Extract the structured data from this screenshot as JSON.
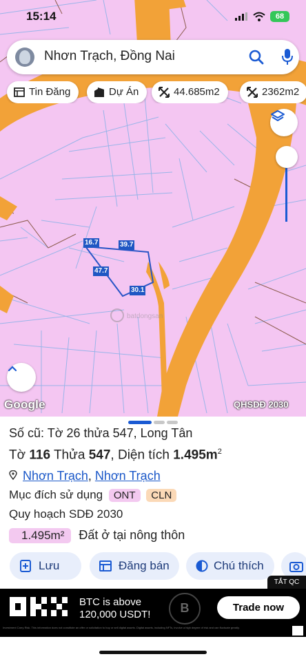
{
  "status_bar": {
    "time": "15:14",
    "battery": "68"
  },
  "search": {
    "query": "Nhơn Trạch, Đồng Nai"
  },
  "chips": [
    {
      "label": "Tin Đăng",
      "icon": "listing-icon"
    },
    {
      "label": "Dự Án",
      "icon": "building-icon"
    },
    {
      "label": "44.685m2",
      "icon": "area-icon"
    },
    {
      "label": "2362m2",
      "icon": "area-icon"
    }
  ],
  "map": {
    "google_label": "Google",
    "layer_tag": "QHSDĐ 2030",
    "parcel_edges": [
      "16.7",
      "39.7",
      "47.7",
      "30.1"
    ],
    "colors": {
      "residential": "#f4c6f2",
      "road": "#f2a238",
      "parcel_outline": "#2754c6"
    }
  },
  "sheet": {
    "old_ref": "Số cũ: Tờ 26 thửa 547, Long Tân",
    "sheet_label": "Tờ",
    "sheet_no": "116",
    "parcel_label": "Thửa",
    "parcel_no": "547",
    "area_label": "Diện tích",
    "area_value": "1.495m",
    "area_sup": "2",
    "district": "Nhơn Trạch",
    "commune": "Nhơn Trạch",
    "purpose_label": "Mục đích sử dụng",
    "purpose_tags": [
      "ONT",
      "CLN"
    ],
    "plan_label": "Quy hoạch SDĐ 2030",
    "plan_area": "1.495m²",
    "plan_use": "Đất ở tại nông thôn",
    "buttons": [
      "Lưu",
      "Đăng bán",
      "Chú thích"
    ]
  },
  "ad": {
    "close_label": "TẮT QC",
    "headline_1": "BTC is above",
    "headline_2": "120,000 USDT!",
    "cta": "Trade now",
    "disclaimer": "Investment Carry Risk. This information does not constitute an offer or solicitation to buy or sell digital assets. Digital assets, including NFTs, involve a high degree of risk and can fluctuate greatly."
  }
}
